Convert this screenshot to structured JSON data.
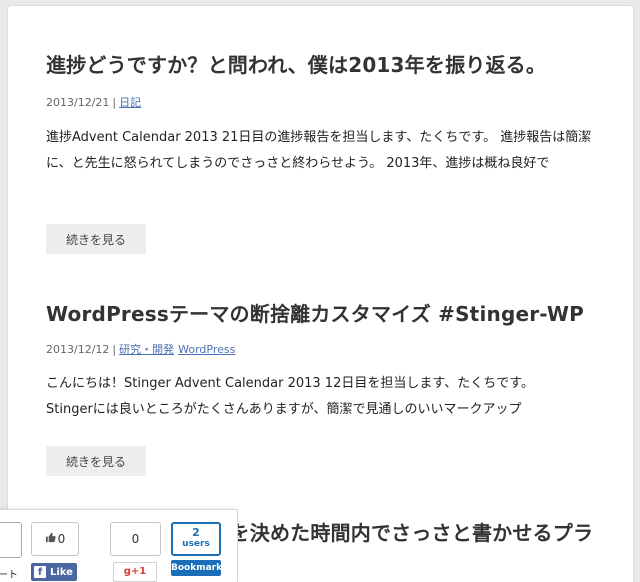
{
  "posts": [
    {
      "title": "進捗どうですか？と問われ、僕は2013年を振り返る。",
      "date": "2013/12/21",
      "separator": "|",
      "categories": [
        "日記"
      ],
      "excerpt": "進捗Advent Calendar 2013 21日目の進捗報告を担当します、たくちです。 進捗報告は簡潔に、と先生に怒られてしまうのでさっさと終わらせよう。 2013年、進捗は概ね良好で",
      "read_more": "続きを見る"
    },
    {
      "title": "WordPressテーマの断捨離カスタマイズ #Stinger-WP",
      "date": "2013/12/12",
      "separator": "|",
      "categories": [
        "研究・開発",
        "WordPress"
      ],
      "excerpt_lines": [
        "こんにちは！Stinger Advent Calendar 2013 12日目を担当します、たくちです。",
        "Stingerには良いところがたくさんありますが、簡潔で見通しのいいマークアップ"
      ],
      "read_more": "続きを見る"
    },
    {
      "title": "WordPressの投稿を決めた時間内でさっさと書かせるプラグイン"
    }
  ],
  "share": {
    "tweet_label": "ート",
    "fb_count": "0",
    "fb_like": "Like",
    "fb_logo": "f",
    "gplus_count": "0",
    "gplus_label": "g+1",
    "hatena_count": "2",
    "hatena_unit": "users",
    "hatena_label": "Bookmark",
    "thumb_icon": "thumbs-up-icon"
  },
  "colors": {
    "link": "#4a6fb3",
    "facebook": "#4a66a0",
    "gplus": "#d73d32",
    "hatena": "#1a6fb8",
    "page_bg": "#e9e9e9",
    "card_bg": "#ffffff"
  }
}
